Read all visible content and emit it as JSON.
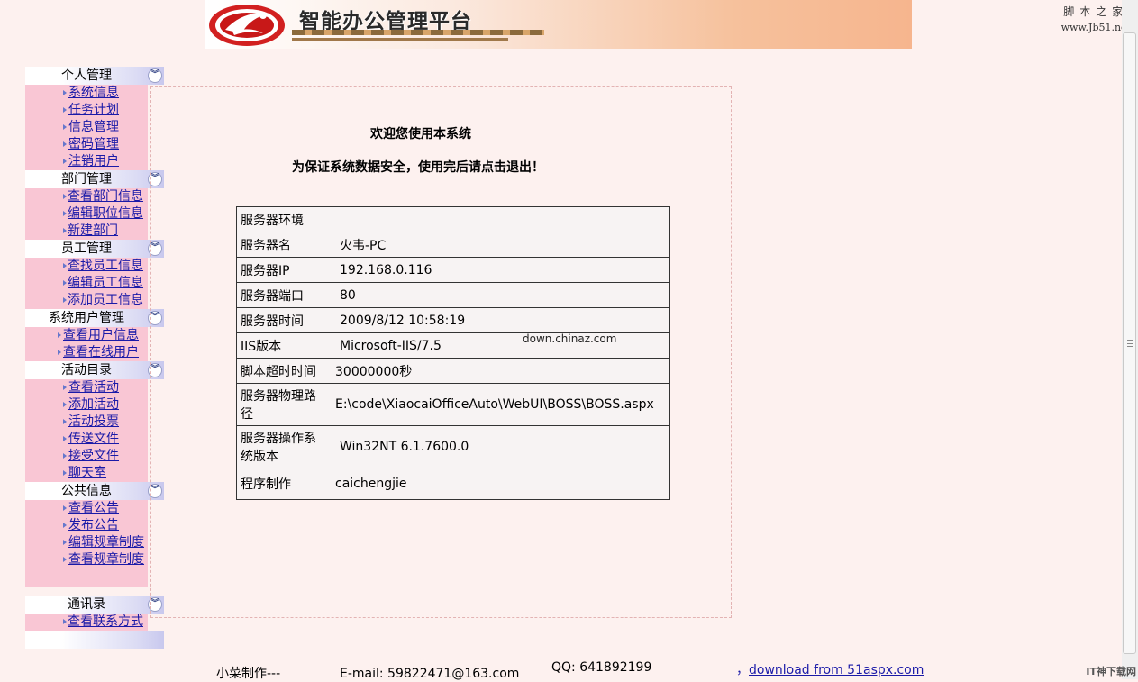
{
  "header": {
    "title": "智能办公管理平台",
    "watermark_line1": "脚本之家",
    "watermark_line2": "www.Jb51.net"
  },
  "sidebar": {
    "groups": [
      {
        "title": "个人管理",
        "items": [
          "系统信息",
          "任务计划",
          "信息管理",
          "密码管理",
          "注销用户"
        ]
      },
      {
        "title": "部门管理",
        "items": [
          "查看部门信息",
          "编辑职位信息",
          "新建部门"
        ]
      },
      {
        "title": "员工管理",
        "items": [
          "查找员工信息",
          "编辑员工信息",
          "添加员工信息"
        ]
      },
      {
        "title": "系统用户管理",
        "items": [
          "查看用户信息",
          "查看在线用户"
        ]
      },
      {
        "title": "活动目录",
        "items": [
          "查看活动",
          "添加活动",
          "活动投票",
          "传送文件",
          "接受文件",
          "聊天室"
        ]
      },
      {
        "title": "公共信息",
        "items": [
          "查看公告",
          "发布公告",
          "编辑规章制度",
          "查看规章制度"
        ]
      },
      {
        "title": "通讯录",
        "items": [
          "查看联系方式"
        ]
      }
    ]
  },
  "main": {
    "welcome": "欢迎您使用本系统",
    "notice": "为保证系统数据安全，使用完后请点击退出！",
    "table_header": "服务器环境",
    "rows": [
      {
        "label": "服务器名",
        "value": "火韦-PC"
      },
      {
        "label": "服务器IP",
        "value": "192.168.0.116"
      },
      {
        "label": "服务器端口",
        "value": "80"
      },
      {
        "label": "服务器时间",
        "value": "2009/8/12 10:58:19"
      },
      {
        "label": "IIS版本",
        "value": "Microsoft-IIS/7.5"
      },
      {
        "label": "脚本超时时间",
        "value": "30000000秒"
      },
      {
        "label": "服务器物理路径",
        "value": "E:\\code\\XiaocaiOfficeAuto\\WebUI\\BOSS\\BOSS.aspx"
      },
      {
        "label": "服务器操作系统版本",
        "value": "Win32NT 6.1.7600.0"
      },
      {
        "label": "程序制作",
        "value": "caichengjie"
      }
    ],
    "overlay_watermark": "down.chinaz.com"
  },
  "footer": {
    "maker": "小菜制作---",
    "email": "E-mail: 59822471@163.com",
    "qq": "QQ: 641892199",
    "download_prefix": "，",
    "download_link": "download from 51aspx.com"
  },
  "corner_watermark": "IT神下载网",
  "colors": {
    "page_bg": "#fdf1ef",
    "menu_item_bg": "#f9c6d4",
    "link": "#1a1aa8",
    "banner_accent": "#f6b58e"
  }
}
